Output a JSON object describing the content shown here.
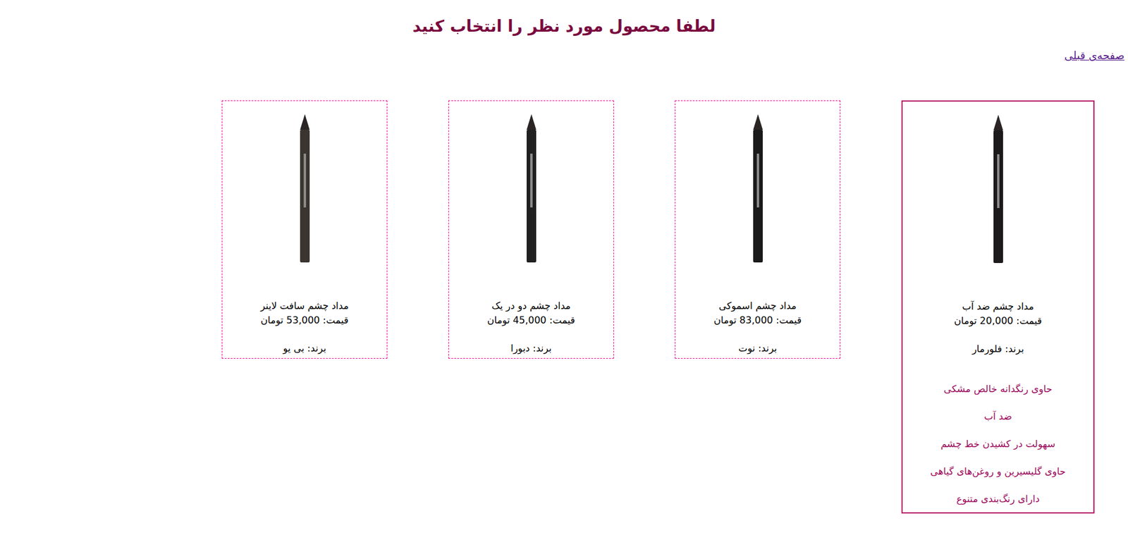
{
  "title": "لطفا محصول مورد نظر را انتخاب کنید",
  "back_link": "صفحه‌ی قبلی",
  "products": [
    {
      "name": "مداد چشم ضد آب",
      "price": "قیمت: 20,000 تومان",
      "brand": "برند: فلورمار",
      "selected": true,
      "features": [
        "حاوی رنگدانه خالص مشکی",
        "ضد آب",
        "سهولت در کشیدن خط چشم",
        "حاوی گلیسیرین و روغن‌های گیاهی",
        "دارای رنگ‌بندی متنوع"
      ]
    },
    {
      "name": "مداد چشم اسموکی",
      "price": "قیمت: 83,000 تومان",
      "brand": "برند: نوت",
      "selected": false,
      "features": []
    },
    {
      "name": "مداد چشم دو در یک",
      "price": "قیمت: 45,000 تومان",
      "brand": "برند: دبورا",
      "selected": false,
      "features": []
    },
    {
      "name": "مداد چشم سافت لاینر",
      "price": "قیمت: 53,000 تومان",
      "brand": "برند: بی یو",
      "selected": false,
      "features": []
    }
  ]
}
